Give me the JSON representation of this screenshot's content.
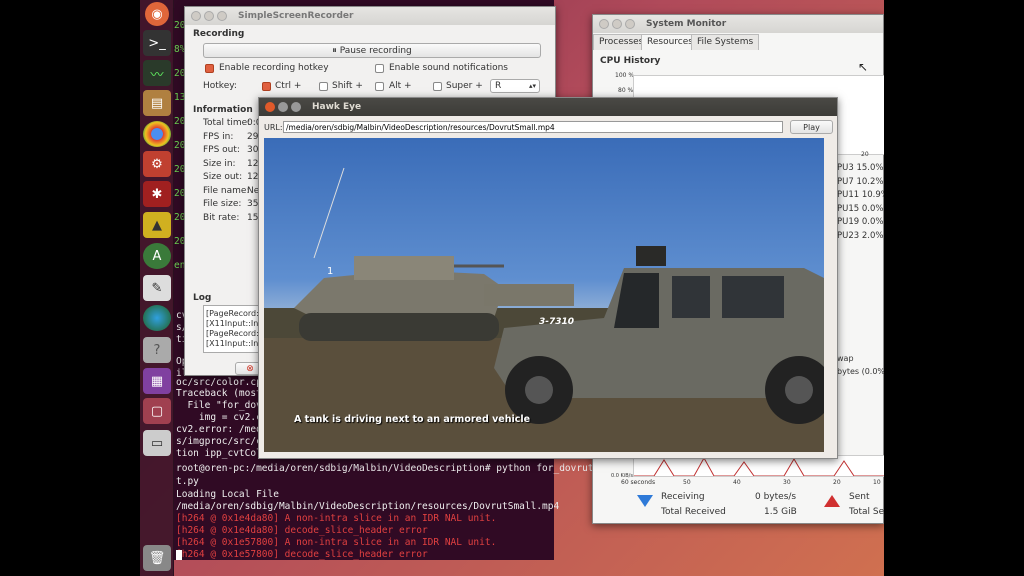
{
  "terminal": {
    "lines_top": [
      "2000",
      "8%",
      "200",
      "13%",
      "200",
      "200",
      "200",
      "200",
      "200",
      "200",
      "en"
    ],
    "lines_mid": [
      "cv",
      "s/",
      "tion",
      "Op",
      "il",
      "oc/src/color.cpp",
      "Traceback (most",
      "  File \"for_dovr",
      "    img = cv2.cv",
      "cv2.error: /med",
      "s/imgproc/src/c",
      "tion ipp_cvtColo"
    ],
    "prompt": "root@oren-pc:/media/oren/sdbig/Malbin/VideoDescription# python for_dovrut.py",
    "prompt_cont": "t.py",
    "loading": "Loading Local File",
    "path": "/media/oren/sdbig/Malbin/VideoDescription/resources/DovrutSmall.mp4",
    "errors": [
      "[h264 @ 0x1e4da80] A non-intra slice in an IDR NAL unit.",
      "[h264 @ 0x1e4da80] decode_slice_header error",
      "[h264 @ 0x1e57800] A non-intra slice in an IDR NAL unit.",
      "[h264 @ 0x1e57800] decode_slice_header error"
    ]
  },
  "ssr": {
    "title": "SimpleScreenRecorder",
    "recording_header": "Recording",
    "pause_button": "Pause recording",
    "enable_hotkey": "Enable recording hotkey",
    "enable_sound": "Enable sound notifications",
    "hotkey_label": "Hotkey:",
    "ctrl": "Ctrl +",
    "shift": "Shift +",
    "alt": "Alt +",
    "super": "Super +",
    "key": "R",
    "information_header": "Information",
    "info_labels": [
      "Total time:",
      "FPS in:",
      "FPS out:",
      "Size in:",
      "Size out:",
      "File name:",
      "File size:",
      "Bit rate:"
    ],
    "info_values": [
      "0:0",
      "29",
      "30",
      "12",
      "12",
      "Ne",
      "35",
      "15"
    ],
    "log_header": "Log",
    "log_lines": [
      "[PageRecord:",
      "[X11Input::Ini",
      "[PageRecord:",
      "[X11Input::Inp"
    ]
  },
  "sysmon": {
    "title": "System Monitor",
    "tabs": [
      "Processes",
      "Resources",
      "File Systems"
    ],
    "cpu_history": "CPU History",
    "pct_100": "100 %",
    "pct_80": "80 %",
    "cpu_list": [
      "PU3 15.0%",
      "PU7 10.2%",
      "PU11 10.9%",
      "PU15 0.0%",
      "PU19 0.0%",
      "PU23 2.0%"
    ],
    "tick_20": "20",
    "wap": "wap",
    "bytes": "bytes (0.0%",
    "kbs": "0.0 KiB/s",
    "axis_60": "60 seconds",
    "axis_50": "50",
    "axis_40": "40",
    "axis_30": "30",
    "axis_20": "20",
    "axis_10": "10",
    "receiving": "Receiving",
    "receiving_val": "0 bytes/s",
    "total_received": "Total Received",
    "total_received_val": "1.5 GiB",
    "sent": "Sent",
    "total_sent": "Total Sen"
  },
  "hawk": {
    "title": "Hawk Eye",
    "url_label": "URL:",
    "url_value": "/media/oren/sdbig/Malbin/VideoDescription/resources/DovrutSmall.mp4",
    "play": "Play",
    "caption": "A tank is driving next to an armored vehicle",
    "jeep_number": "3-7310",
    "tank_number": "1"
  }
}
